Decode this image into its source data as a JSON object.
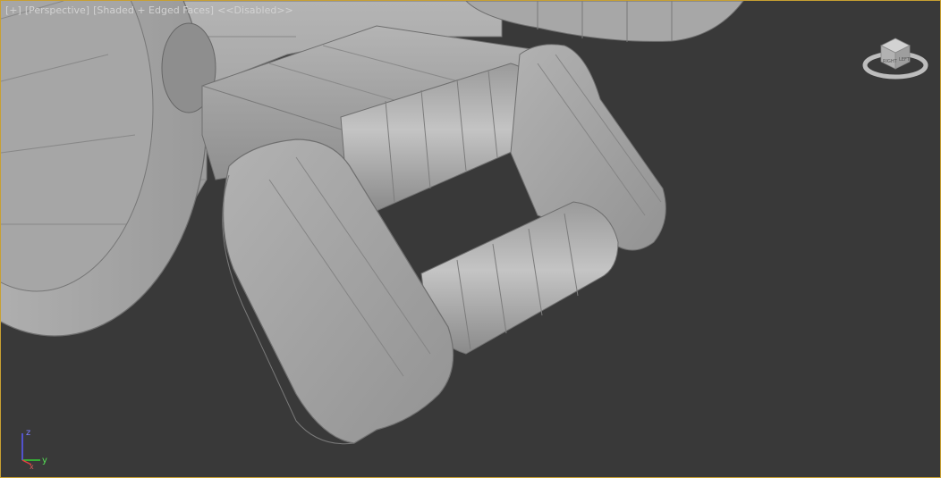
{
  "viewport": {
    "labels": {
      "menu": "[+]",
      "view": "[Perspective]",
      "shading": "[Shaded + Edged Faces]",
      "status": "<<Disabled>>"
    },
    "axes": {
      "x": "x",
      "y": "y",
      "z": "z"
    },
    "viewcube": {
      "face_label": "RIGHT",
      "side_label": "LEFT"
    },
    "colors": {
      "background": "#393939",
      "border": "#c8a032",
      "mesh": "#a8a8a8",
      "edge": "#6f6f6f"
    }
  }
}
